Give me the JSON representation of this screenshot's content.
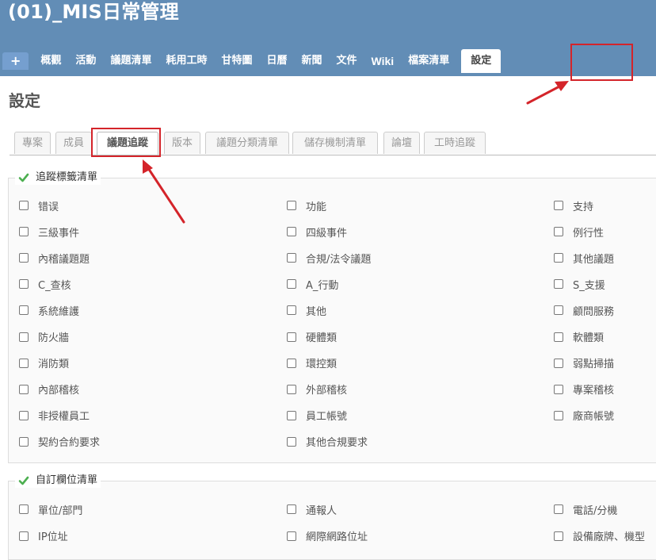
{
  "header": {
    "project_title": "(01)_MIS日常管理"
  },
  "main_menu": {
    "new_object": "+",
    "items": [
      "概觀",
      "活動",
      "議題清單",
      "耗用工時",
      "甘特圖",
      "日曆",
      "新聞",
      "文件",
      "Wiki",
      "檔案清單"
    ],
    "selected": "設定"
  },
  "page": {
    "heading": "設定"
  },
  "tabs": {
    "items": [
      "專案",
      "成員",
      "議題追蹤",
      "版本",
      "議題分類清單",
      "儲存機制清單",
      "論壇",
      "工時追蹤"
    ],
    "active_index": 2
  },
  "trackers": {
    "legend": "追蹤標籤清單",
    "items": [
      "错误",
      "功能",
      "支持",
      "三級事件",
      "四級事件",
      "例行性",
      "內稽議題題",
      "合規/法令議題",
      "其他議題",
      "C_查核",
      "A_行動",
      "S_支援",
      "系統維護",
      "其他",
      "顧問服務",
      "防火牆",
      "硬體類",
      "軟體類",
      "消防類",
      "環控類",
      "弱點掃描",
      "內部稽核",
      "外部稽核",
      "專案稽核",
      "非授權員工",
      "員工帳號",
      "廠商帳號",
      "契約合約要求",
      "其他合規要求"
    ]
  },
  "custom_fields": {
    "legend": "自訂欄位清單",
    "items": [
      "單位/部門",
      "通報人",
      "電話/分機",
      "IP位址",
      "網際網路位址",
      "設備廠牌、機型"
    ]
  },
  "colors": {
    "header": "#628db6",
    "highlight": "#d4242a",
    "check": "#4caf50"
  }
}
